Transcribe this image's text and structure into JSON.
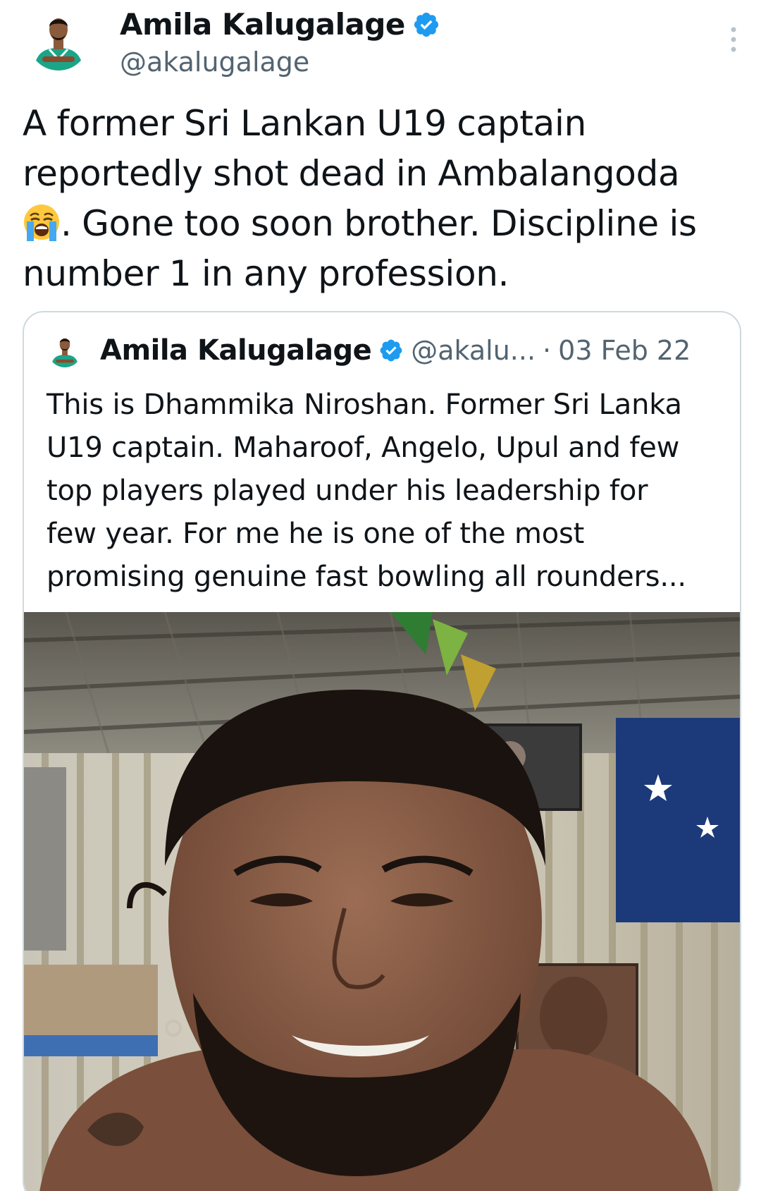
{
  "author": {
    "display_name": "Amila Kalugalage",
    "handle": "@akalugalage",
    "verified_badge_icon": "verified-check-icon"
  },
  "tweet": {
    "lines": [
      "A former Sri Lankan U19 captain",
      "reportedly shot dead in Ambalangoda",
      ". Gone too soon brother. Discipline is",
      "number 1 in any profession."
    ],
    "emoji_icon": "loudly-crying-face-emoji"
  },
  "quoted": {
    "display_name": "Amila Kalugalage",
    "handle": "@akalu...",
    "separator": "·",
    "date": "03 Feb 22",
    "lines": [
      "This is Dhammika Niroshan. Former Sri Lanka",
      "U19 captain. Maharoof, Angelo, Upul and few",
      "top players played under his leadership for",
      "few year. For me he is one of the most",
      "promising genuine fast bowling all rounders..."
    ],
    "image_icon": "photo-smiling-bearded-man"
  },
  "colors": {
    "text": "#0f1419",
    "secondary": "#536471",
    "verified": "#1d9bf0",
    "border": "#cfd9de"
  }
}
